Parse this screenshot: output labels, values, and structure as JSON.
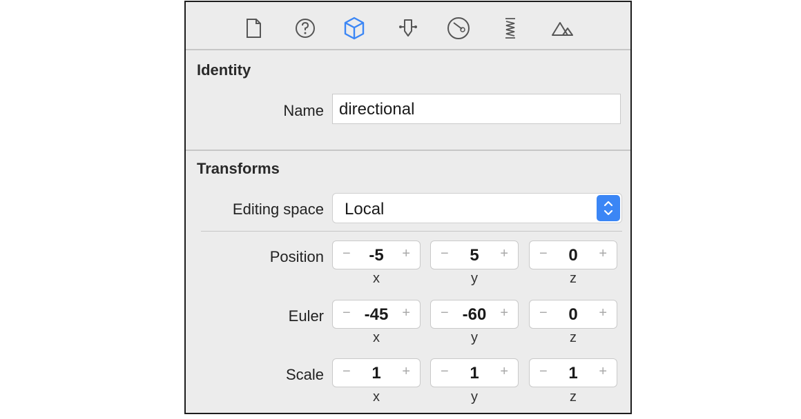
{
  "toolbar": {
    "icons": [
      "file-icon",
      "help-icon",
      "cube-icon",
      "attributes-icon",
      "material-icon",
      "physics-icon",
      "scene-icon"
    ],
    "selected": "cube-icon",
    "accent": "#3b86f5"
  },
  "identity": {
    "title": "Identity",
    "name_label": "Name",
    "name_value": "directional"
  },
  "transforms": {
    "title": "Transforms",
    "editing_space_label": "Editing space",
    "editing_space_value": "Local",
    "position": {
      "label": "Position",
      "x": "-5",
      "y": "5",
      "z": "0"
    },
    "euler": {
      "label": "Euler",
      "x": "-45",
      "y": "-60",
      "z": "0"
    },
    "scale": {
      "label": "Scale",
      "x": "1",
      "y": "1",
      "z": "1"
    },
    "axis_labels": {
      "x": "x",
      "y": "y",
      "z": "z"
    },
    "minus_glyph": "−",
    "plus_glyph": "+"
  }
}
